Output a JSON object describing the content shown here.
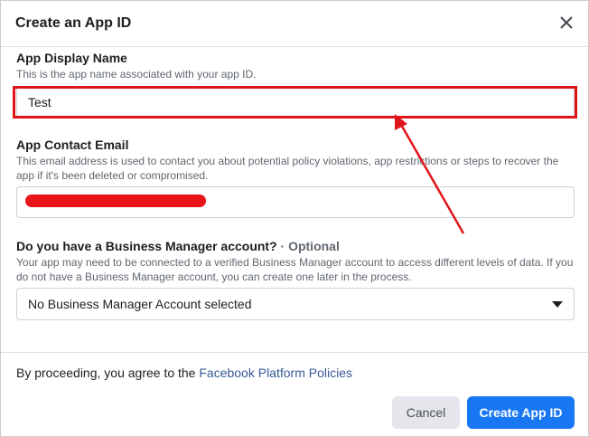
{
  "dialog": {
    "title": "Create an App ID",
    "close_icon": "close-icon"
  },
  "display_name": {
    "label": "App Display Name",
    "help": "This is the app name associated with your app ID.",
    "value": "Test"
  },
  "contact_email": {
    "label": "App Contact Email",
    "help": "This email address is used to contact you about potential policy violations, app restrictions or steps to recover the app if it's been deleted or compromised.",
    "value": ""
  },
  "business_manager": {
    "label": "Do you have a Business Manager account?",
    "optional": "· Optional",
    "help": "Your app may need to be connected to a verified Business Manager account to access different levels of data. If you do not have a Business Manager account, you can create one later in the process.",
    "selected": "No Business Manager Account selected"
  },
  "footer": {
    "agree_prefix": "By proceeding, you agree to the",
    "policy_link": "Facebook Platform Policies"
  },
  "buttons": {
    "cancel": "Cancel",
    "create": "Create App ID"
  },
  "colors": {
    "annotation_red": "#e0151a",
    "primary_blue": "#1877f2",
    "link_blue": "#385898"
  }
}
